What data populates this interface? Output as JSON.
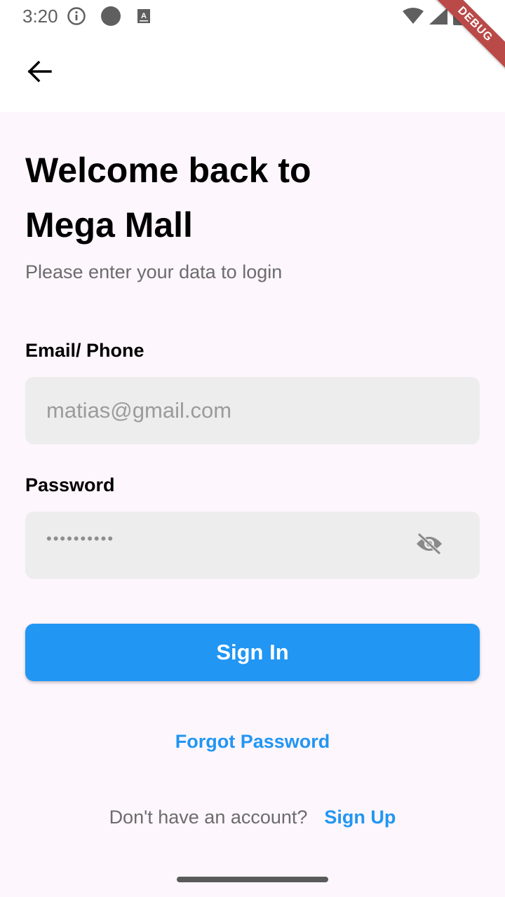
{
  "status_bar": {
    "time": "3:20",
    "debug_label": "DEBUG",
    "icons": [
      "info-icon",
      "circle-icon",
      "keyboard-a-icon",
      "wifi-icon",
      "signal-icon",
      "battery-icon"
    ]
  },
  "app_bar": {
    "back_icon": "arrow-back-icon"
  },
  "header": {
    "title": "Welcome back to Mega Mall",
    "subtitle": "Please enter your data to login"
  },
  "form": {
    "email_label": "Email/ Phone",
    "email_placeholder": "matias@gmail.com",
    "password_label": "Password",
    "password_value": "••••••••••",
    "visibility_icon": "visibility-off-icon"
  },
  "actions": {
    "sign_in": "Sign In",
    "forgot_password": "Forgot Password",
    "signup_prompt": "Don't have an account?",
    "sign_up": "Sign Up"
  },
  "colors": {
    "primary": "#2196f3",
    "background": "#fdf6fc",
    "input_fill": "#ededed",
    "debug_ribbon": "#b94a48"
  }
}
